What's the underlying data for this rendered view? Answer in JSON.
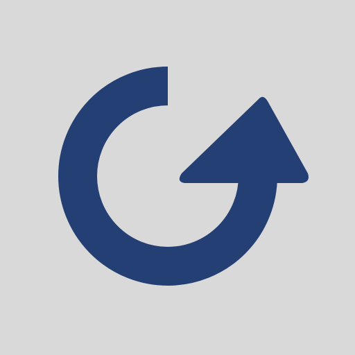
{
  "icon": {
    "name": "refresh-icon",
    "color": "#243f73",
    "background": "#d9d9d9"
  }
}
